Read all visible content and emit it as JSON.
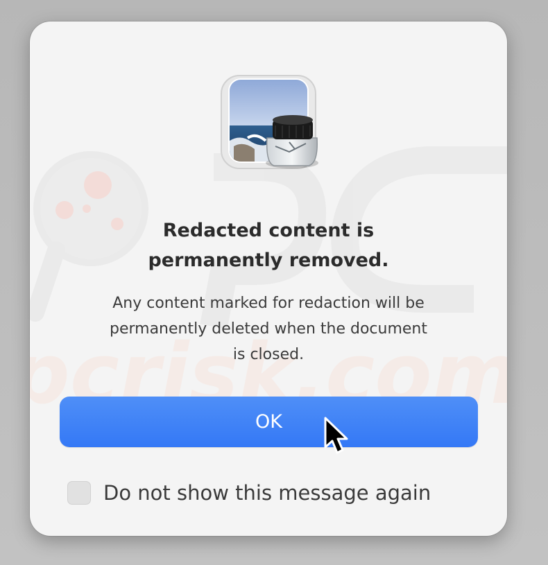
{
  "dialog": {
    "icon": "preview-app-icon",
    "title_line1": "Redacted content is",
    "title_line2": "permanently removed.",
    "message_line1": "Any content marked for redaction will be",
    "message_line2": "permanently deleted when the document",
    "message_line3": "is closed.",
    "ok_label": "OK",
    "checkbox_label": "Do not show this message again",
    "checkbox_checked": false
  },
  "watermark": {
    "text": "pcrisk.com"
  },
  "colors": {
    "accent": "#3478f6",
    "dialog_background": "#f4f4f4",
    "title_text": "#2b2b2b",
    "body_text": "#3a3a3a"
  }
}
